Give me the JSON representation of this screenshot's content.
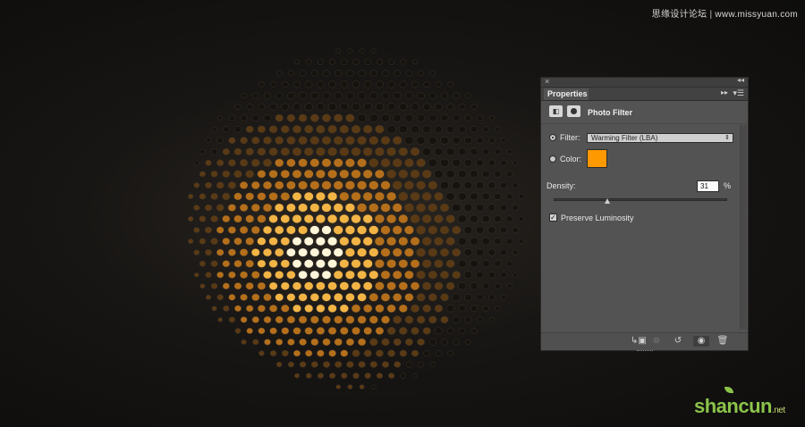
{
  "watermark": {
    "top_cn": "思缘设计论坛",
    "top_url": "www.missyuan.com",
    "bottom_logo": "shancun",
    "bottom_suffix": ".net"
  },
  "panel": {
    "tab_label": "Properties",
    "layer_title": "Photo Filter",
    "filter_label": "Filter:",
    "filter_value": "Warming Filter (LBA)",
    "color_label": "Color:",
    "color_value": "#ff9900",
    "density_label": "Density:",
    "density_value": "31",
    "density_unit": "%",
    "density_fraction": 0.31,
    "preserve_luminosity_label": "Preserve Luminosity",
    "preserve_luminosity_checked": true,
    "selected_option": "filter"
  },
  "icons": {
    "close": "close-icon",
    "collapse": "collapse-icon",
    "expand": "expand-icon",
    "menu": "panel-menu-icon",
    "adjustment": "photo-filter-adjustment-icon",
    "mask": "layer-mask-icon",
    "clip": "clip-to-layer-icon",
    "view_previous": "view-previous-state-icon",
    "reset": "reset-icon",
    "visibility": "eye-icon",
    "delete": "trash-icon"
  },
  "colors": {
    "panel_bg": "#535353",
    "filter_color": "#ff9900",
    "glow": "#ffb43c"
  }
}
